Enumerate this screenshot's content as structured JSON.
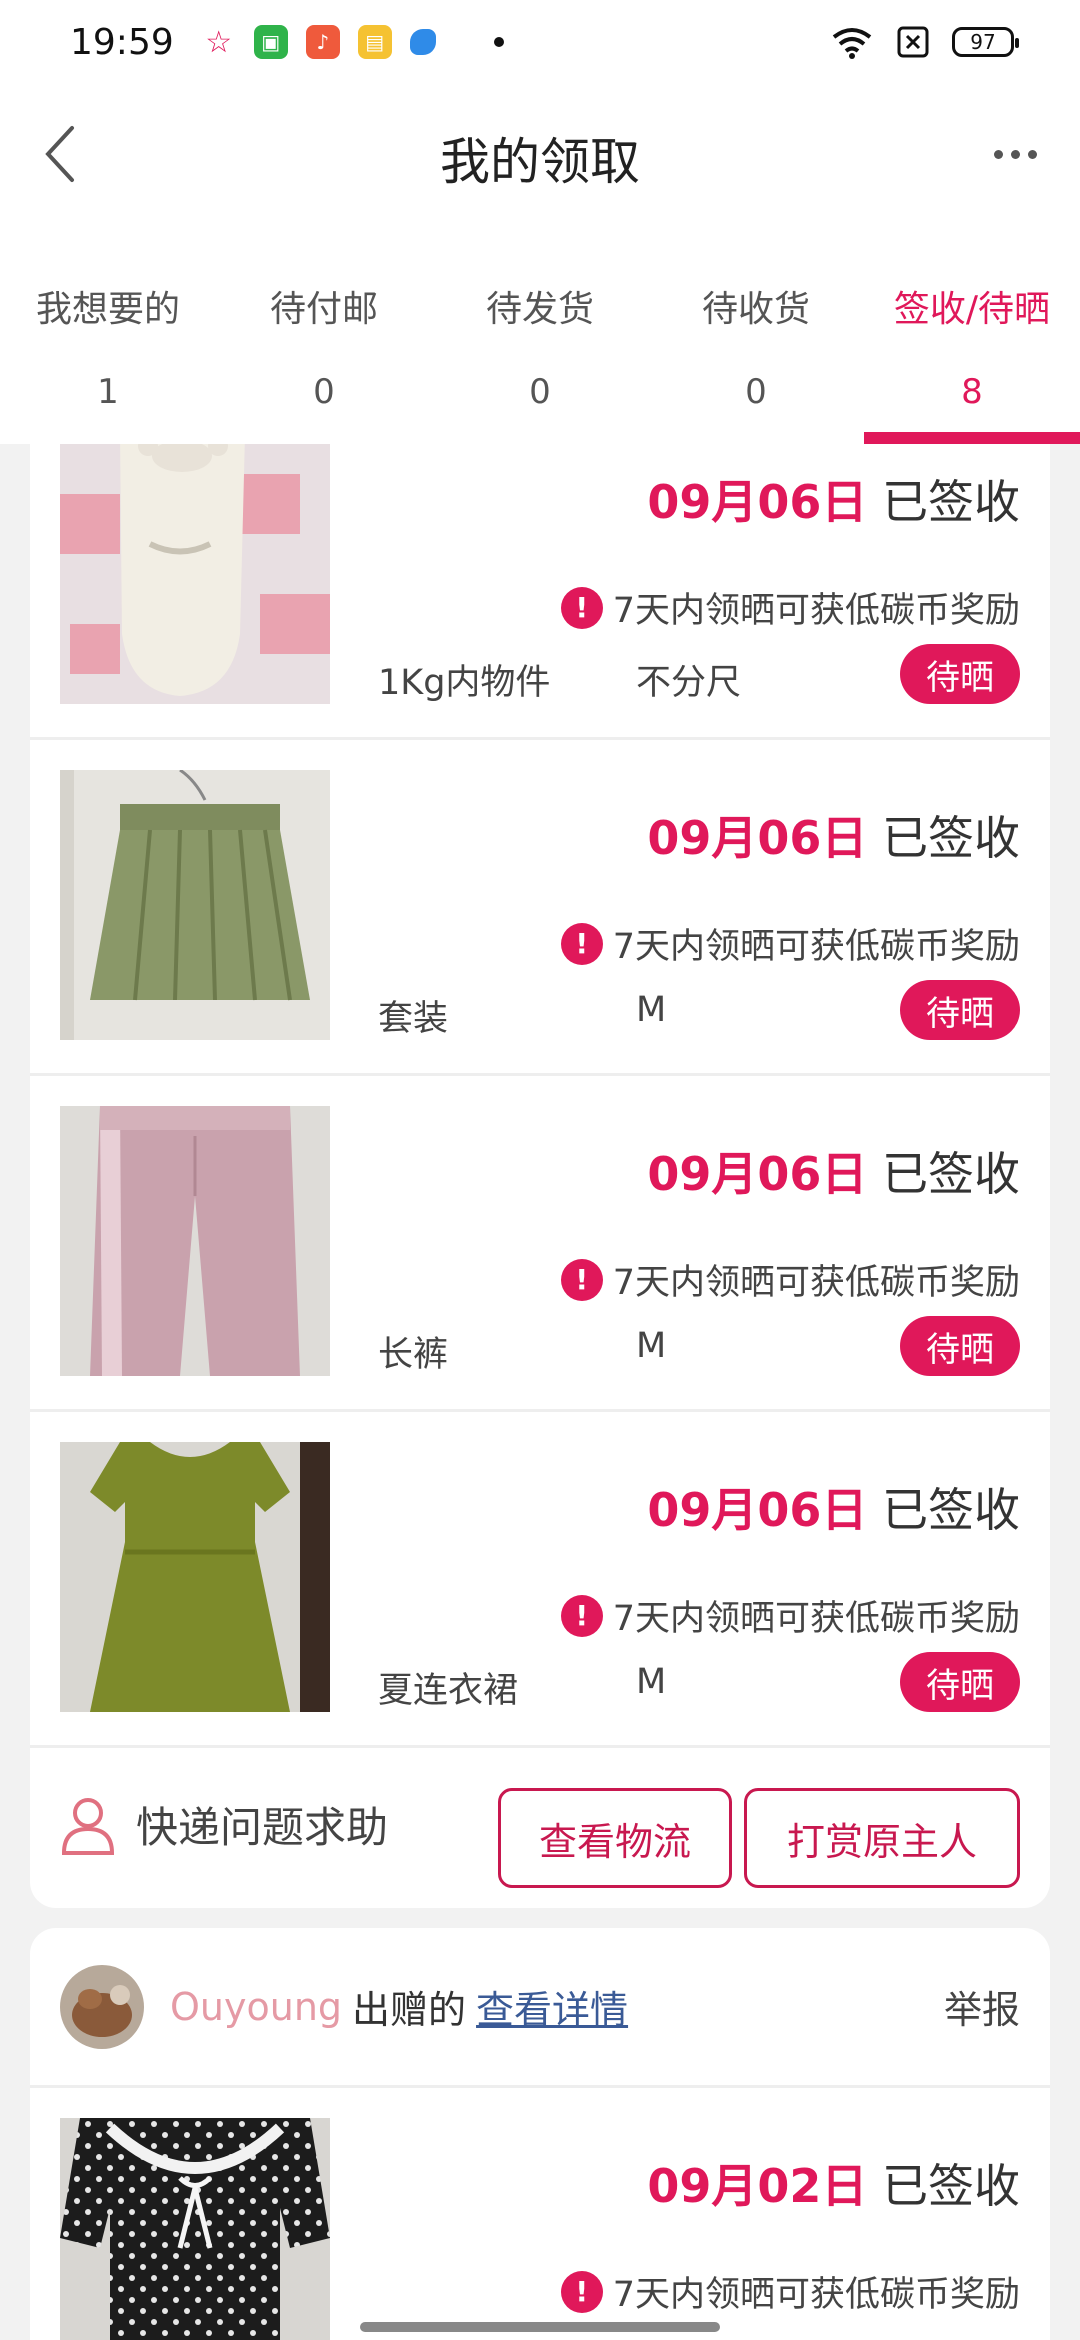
{
  "status_bar": {
    "time": "19:59",
    "battery": "97",
    "notification_icons": [
      "star-icon",
      "shop-icon",
      "music-icon",
      "store-icon",
      "app-icon"
    ]
  },
  "header": {
    "title": "我的领取"
  },
  "tabs": [
    {
      "label": "我想要的",
      "count": "1"
    },
    {
      "label": "待付邮",
      "count": "0"
    },
    {
      "label": "待发货",
      "count": "0"
    },
    {
      "label": "待收货",
      "count": "0"
    },
    {
      "label": "签收/待晒",
      "count": "8"
    }
  ],
  "colors": {
    "accent": "#e0185a",
    "link": "#3a5a96",
    "giver_name": "#e59aa5"
  },
  "card1": {
    "items": [
      {
        "date": "09月06日",
        "status": "已签收",
        "reward": "7天内领晒可获低碳币奖励",
        "name": "1Kg内物件",
        "size": "不分尺",
        "button": "待晒"
      },
      {
        "date": "09月06日",
        "status": "已签收",
        "reward": "7天内领晒可获低碳币奖励",
        "name": "套装",
        "size": "M",
        "button": "待晒"
      },
      {
        "date": "09月06日",
        "status": "已签收",
        "reward": "7天内领晒可获低碳币奖励",
        "name": "长裤",
        "size": "M",
        "button": "待晒"
      },
      {
        "date": "09月06日",
        "status": "已签收",
        "reward": "7天内领晒可获低碳币奖励",
        "name": "夏连衣裙",
        "size": "M",
        "button": "待晒"
      }
    ],
    "help_label": "快递问题求助",
    "logistics_button": "查看物流",
    "tip_button": "打赏原主人"
  },
  "card2": {
    "giver_name": "Ouyoung",
    "giver_text": "出赠的",
    "details_link": "查看详情",
    "report": "举报",
    "items": [
      {
        "date": "09月02日",
        "status": "已签收",
        "reward": "7天内领晒可获低碳币奖励"
      }
    ]
  }
}
